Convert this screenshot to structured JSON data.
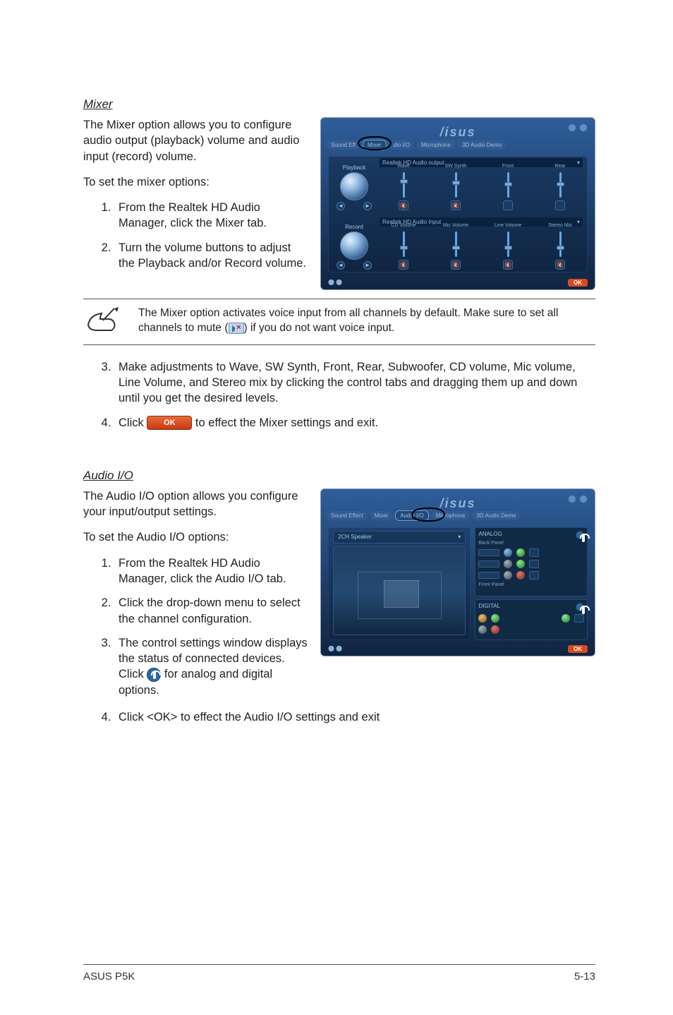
{
  "sections": {
    "mixer": {
      "heading": "Mixer",
      "intro": "The Mixer option allows you to configure audio output (playback) volume and audio input (record) volume.",
      "toSet": "To set the mixer options:",
      "steps12": [
        "From the Realtek HD Audio Manager, click the Mixer tab.",
        "Turn the volume buttons to adjust the Playback and/or Record volume."
      ],
      "note_a": "The Mixer option activates voice input from all channels by default. Make sure to set all channels to mute (",
      "note_b": ") if you do not want voice input.",
      "steps34": [
        "Make adjustments to Wave, SW Synth, Front, Rear, Subwoofer, CD volume, Mic volume, Line Volume, and Stereo mix by clicking the control tabs and dragging them up and down until you get the desired levels.",
        {
          "pre": "Click ",
          "post": " to effect the Mixer settings and exit."
        }
      ]
    },
    "audioio": {
      "heading": "Audio I/O",
      "intro": "The Audio I/O option allows you configure your input/output settings.",
      "toSet": "To set the Audio I/O options:",
      "steps": [
        "From the Realtek HD Audio Manager, click the Audio I/O tab.",
        "Click the drop-down menu to select the channel configuration.",
        {
          "pre": "The control settings window displays the status of connected devices. Click ",
          "post": " for analog and digital options."
        },
        "Click <OK> to effect the Audio I/O settings and exit"
      ]
    }
  },
  "screenshots": {
    "brand": "/isus",
    "mixer": {
      "tabs": [
        "Sound Eff",
        "Mixer",
        "dio I/O",
        "Microphone",
        "3D Audio Demo"
      ],
      "playback_label": "Playback",
      "record_label": "Record",
      "header1_left": "Realtek HD Audio output",
      "header2_left": "Realtek HD Audio Input",
      "sliders_top": [
        "Wave",
        "SW Synth",
        "Front",
        "Rear"
      ],
      "sliders_bot": [
        "CD Volume",
        "Mic Volume",
        "Line Volume",
        "Stereo Mix"
      ],
      "ok": "OK"
    },
    "audioio": {
      "tabs": [
        "Sound Effect",
        "Mixer",
        "Audio I/O",
        "Microphone",
        "3D Audio Demo"
      ],
      "drop_label": "2CH Speaker",
      "analog": "ANALOG",
      "back": "Back Panel",
      "front": "Front Panel",
      "digital": "DIGITAL",
      "ok": "OK"
    }
  },
  "inline": {
    "ok_label": "OK"
  },
  "footer": {
    "left": "ASUS P5K",
    "right": "5-13"
  }
}
